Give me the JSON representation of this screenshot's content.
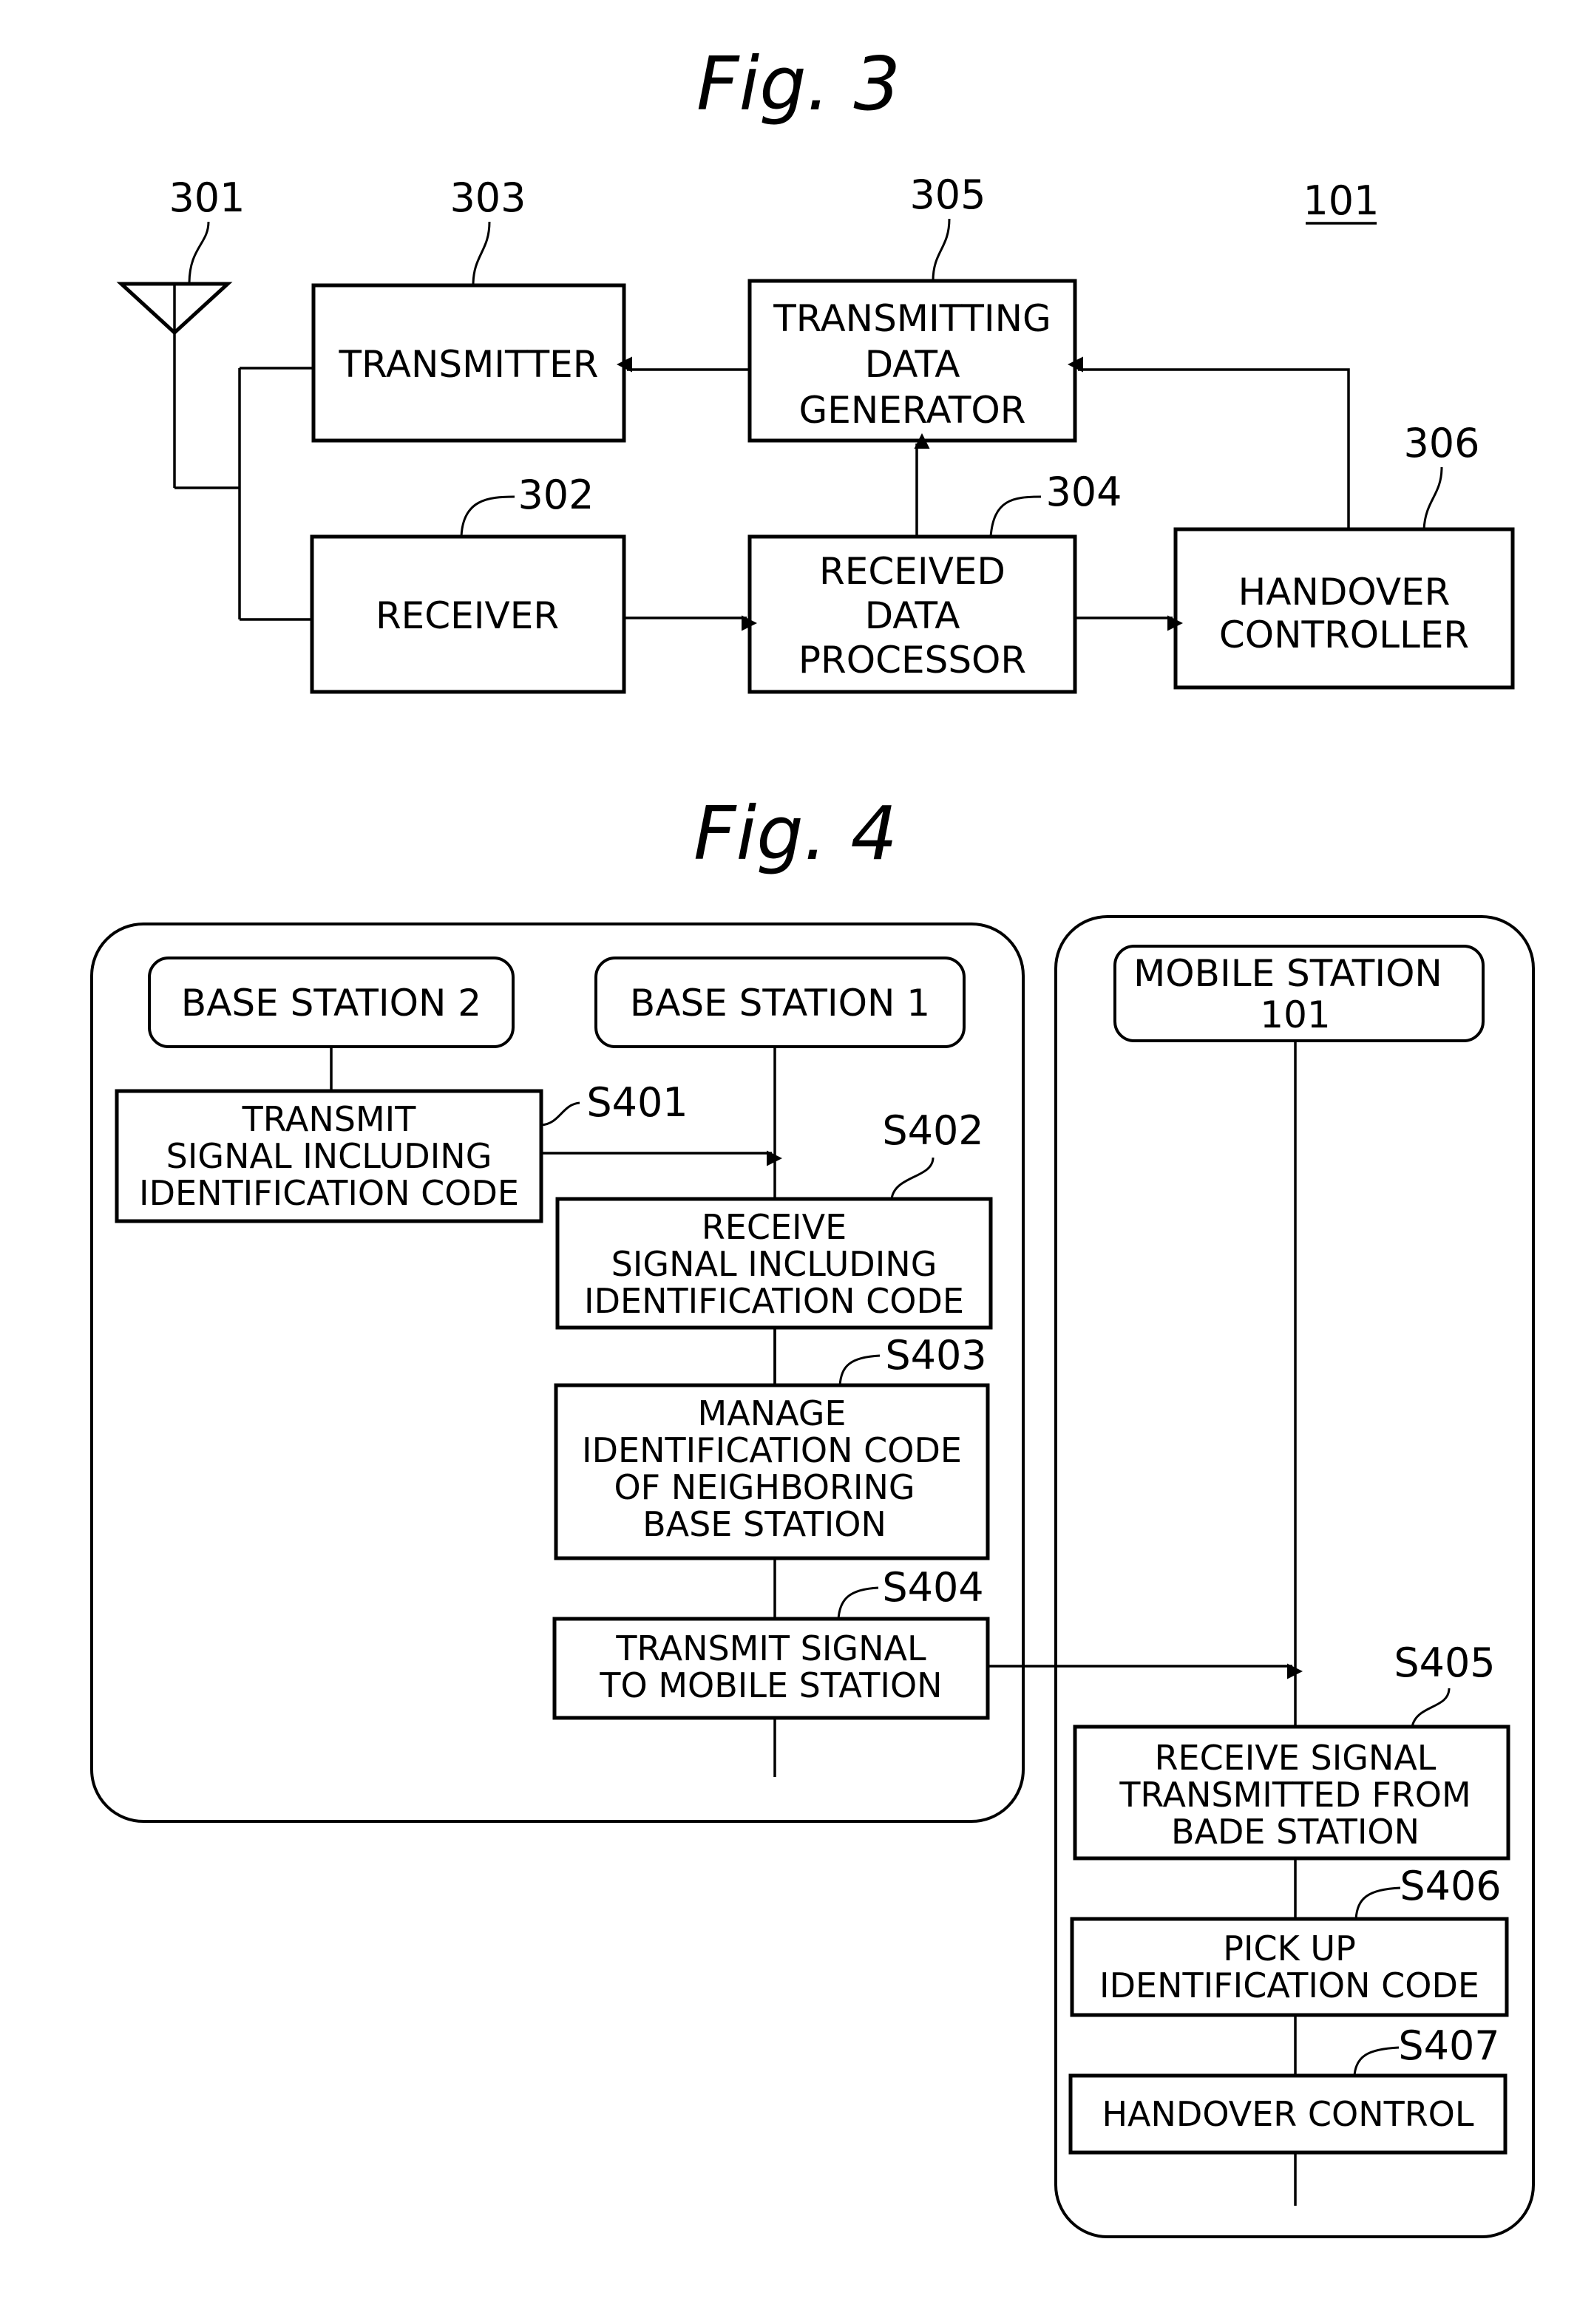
{
  "fig3": {
    "title": "Fig. 3",
    "device_ref": "101",
    "antenna": {
      "ref": "301"
    },
    "blocks": {
      "transmitter": {
        "ref": "303",
        "lines": [
          "TRANSMITTER"
        ]
      },
      "receiver": {
        "ref": "302",
        "lines": [
          "RECEIVER"
        ]
      },
      "tdg": {
        "ref": "305",
        "lines": [
          "TRANSMITTING",
          "DATA",
          "GENERATOR"
        ]
      },
      "rdp": {
        "ref": "304",
        "lines": [
          "RECEIVED",
          "DATA",
          "PROCESSOR"
        ]
      },
      "hc": {
        "ref": "306",
        "lines": [
          "HANDOVER",
          "CONTROLLER"
        ]
      }
    }
  },
  "fig4": {
    "title": "Fig. 4",
    "actors": {
      "bs2": {
        "lines": [
          "BASE STATION 2"
        ]
      },
      "bs1": {
        "lines": [
          "BASE STATION 1"
        ]
      },
      "ms": {
        "lines": [
          "MOBILE STATION",
          "101"
        ]
      }
    },
    "steps": {
      "s401": {
        "id": "S401",
        "lines": [
          "TRANSMIT",
          "SIGNAL INCLUDING",
          "IDENTIFICATION CODE"
        ]
      },
      "s402": {
        "id": "S402",
        "lines": [
          "RECEIVE",
          "SIGNAL INCLUDING",
          "IDENTIFICATION CODE"
        ]
      },
      "s403": {
        "id": "S403",
        "lines": [
          "MANAGE",
          "IDENTIFICATION CODE",
          "OF NEIGHBORING",
          "BASE STATION"
        ]
      },
      "s404": {
        "id": "S404",
        "lines": [
          "TRANSMIT SIGNAL",
          "TO MOBILE STATION"
        ]
      },
      "s405": {
        "id": "S405",
        "lines": [
          "RECEIVE SIGNAL",
          "TRANSMITTED FROM",
          "BADE STATION"
        ]
      },
      "s406": {
        "id": "S406",
        "lines": [
          "PICK UP",
          "IDENTIFICATION CODE"
        ]
      },
      "s407": {
        "id": "S407",
        "lines": [
          "HANDOVER CONTROL"
        ]
      }
    }
  }
}
